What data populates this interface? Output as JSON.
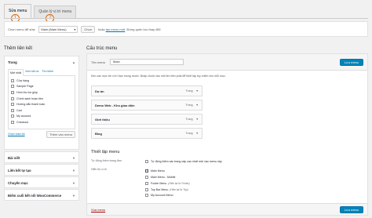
{
  "tabs": [
    {
      "label": "Sửa menu",
      "badge": "1"
    },
    {
      "label": "Quản lý vị trí menu",
      "badge": "2"
    }
  ],
  "select_bar": {
    "label": "Chọn menu để sửa:",
    "selected": "Main (Main Menu)",
    "button": "Chọn",
    "or_text": "hoặc",
    "create_link": "tạo menu mới",
    "after_text": ". Đừng quên lưu thay đổi!"
  },
  "left": {
    "title": "Thêm liên kết",
    "pages_panel": {
      "title": "Trang",
      "subtabs": [
        "Mới nhất",
        "Xem tất cả",
        "Tìm kiếm"
      ],
      "items": [
        "Cửa hàng",
        "Sample Page",
        "Hình thu trợ giúp",
        "Chính sách hoàn tiền",
        "Hướng dẫn thanh toán",
        "Cart",
        "My account",
        "Checkout"
      ],
      "select_all": "Chọn toàn bộ",
      "add_button": "Thêm vào menu"
    },
    "collapsed_panels": [
      "Bài viết",
      "Liên kết tự tạo",
      "Chuyên mục",
      "Điểm cuối kết nối WooCommerce"
    ]
  },
  "right": {
    "title": "Cấu trúc menu",
    "name_label": "Tên menu",
    "name_value": "Main",
    "save_label": "Lưu menu",
    "hint": "Kéo các mục tới vị trí bạn mong muốn. Nhấp chuột vào mũi tên bên phải để thiết lập tùy chỉnh cho mỗi mục.",
    "menu_items": [
      {
        "title": "Dự án",
        "type": "Trang"
      },
      {
        "title": "Demo Web - Kho giao diện",
        "type": "Trang"
      },
      {
        "title": "Giới thiệu",
        "type": "Trang"
      },
      {
        "title": "Blog",
        "type": "Trang"
      }
    ],
    "settings": {
      "title": "Thiết lập menu",
      "auto_add_label": "Tự động thêm trang đơn",
      "auto_add_option": "Tự động thêm các trang cấp cao nhất mới vào menu này",
      "location_label": "Hiển thị vị trí",
      "locations": [
        {
          "label": "Main Menu",
          "note": "",
          "checked": true
        },
        {
          "label": "Main Menu - Mobile",
          "note": "",
          "checked": false
        },
        {
          "label": "Footer Menu",
          "note": "(Hiện tại là: Footer)",
          "checked": false
        },
        {
          "label": "Top Bar Menu",
          "note": "(Hiện tại là: Top)",
          "checked": false
        },
        {
          "label": "My Account Menu",
          "note": "",
          "checked": false
        }
      ]
    },
    "delete_label": "Xóa menu"
  }
}
